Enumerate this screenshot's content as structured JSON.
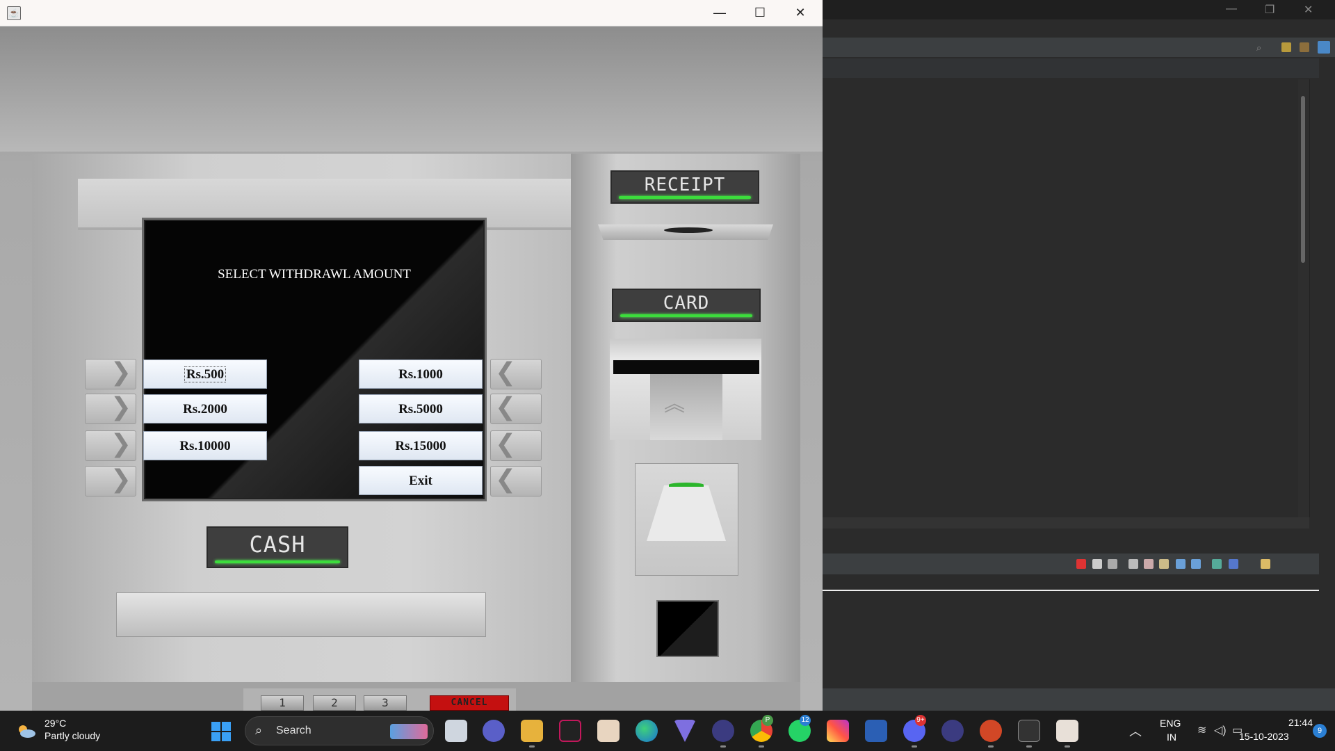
{
  "atm": {
    "screen_title": "SELECT WITHDRAWL AMOUNT",
    "amounts_left": [
      "Rs.500",
      "Rs.2000",
      "Rs.10000"
    ],
    "amounts_right": [
      "Rs.1000",
      "Rs.5000",
      "Rs.15000"
    ],
    "exit_label": "Exit",
    "receipt_label": "RECEIPT",
    "card_label": "CARD",
    "cash_label": "CASH",
    "pin_keys": [
      "1",
      "2",
      "3"
    ],
    "cancel_label": "CANCEL",
    "side_key_left_glyph": "❯",
    "side_key_right_glyph": "❮"
  },
  "window": {
    "minimize_glyph": "—",
    "maximize_glyph": "☐",
    "close_glyph": "✕"
  },
  "taskbar": {
    "weather_temp": "29°C",
    "weather_condition": "Partly cloudy",
    "search_placeholder": "Search",
    "language_line1": "ENG",
    "language_line2": "IN",
    "time": "21:44",
    "date": "15-10-2023",
    "notification_count": "9",
    "badges": {
      "chrome": "P",
      "whatsapp": "12",
      "discord": "9+"
    },
    "apps": [
      "widgets",
      "task-view",
      "teams",
      "file-explorer",
      "app-v",
      "photos",
      "edge",
      "vpn",
      "eclipse",
      "chrome",
      "whatsapp",
      "instagram",
      "word",
      "discord",
      "eclipse-2",
      "powerpoint",
      "terminal",
      "java"
    ]
  },
  "colors": {
    "accent_green": "#3cdc3c",
    "cancel_red": "#c41010",
    "taskbar_bg": "#1c1c1c",
    "ide_bg": "#2b2b2b"
  }
}
